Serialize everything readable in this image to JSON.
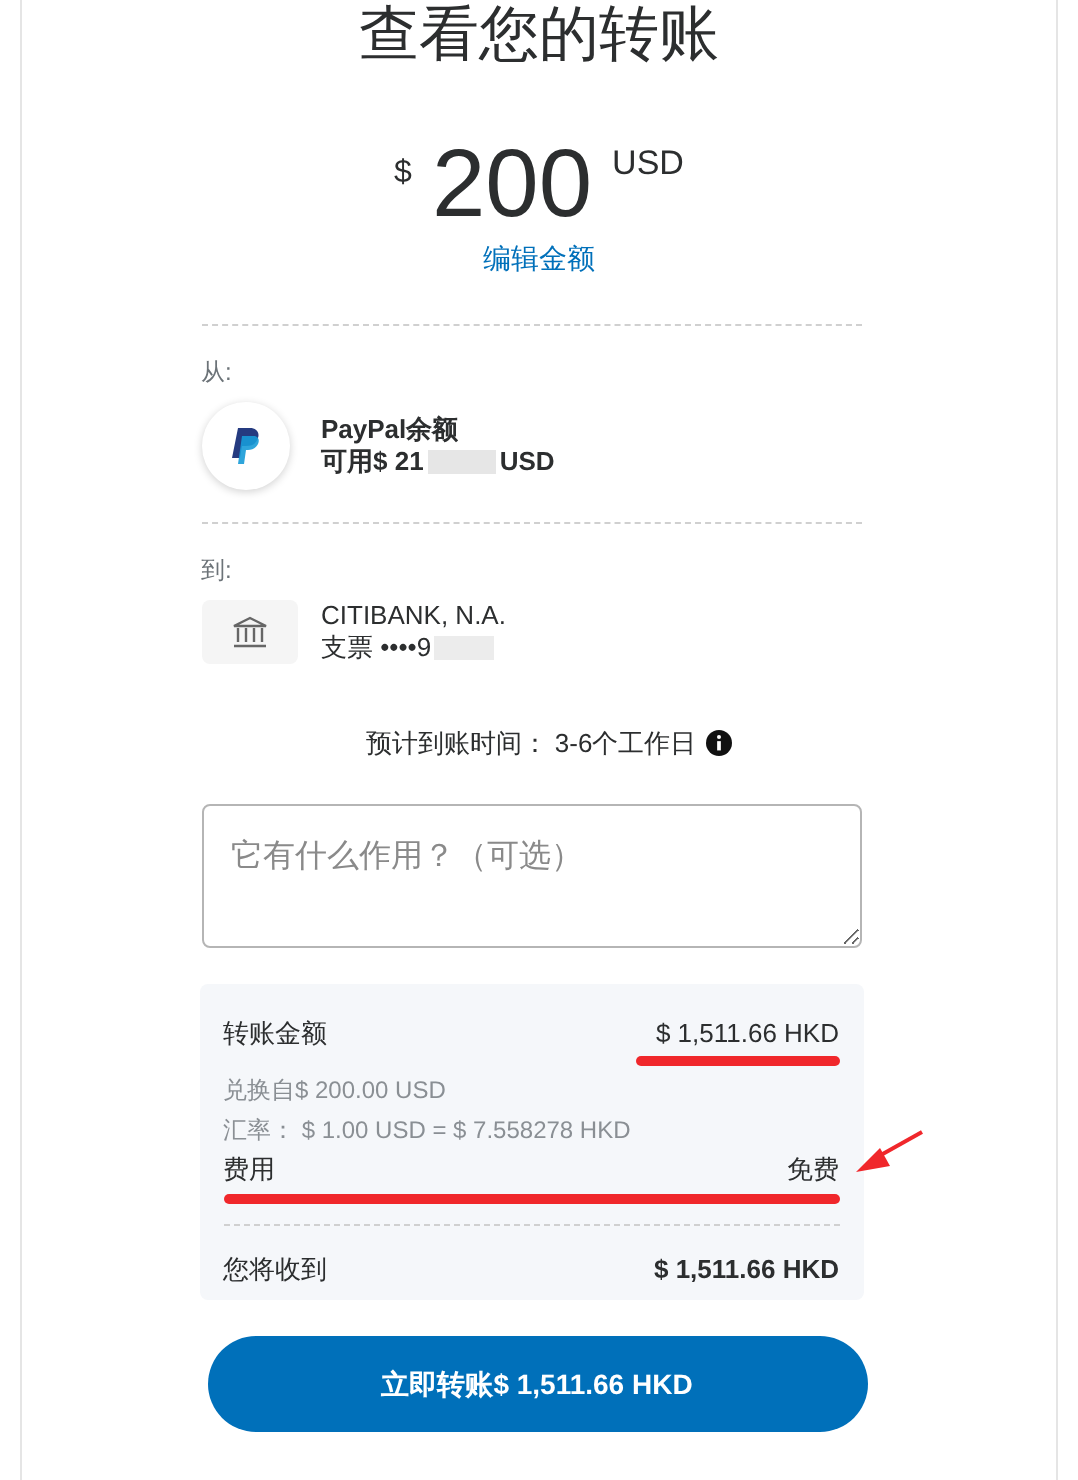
{
  "title": "查看您的转账",
  "amount": {
    "currency_symbol": "$",
    "value": "200",
    "currency": "USD",
    "edit_link": "编辑金额"
  },
  "from": {
    "label": "从:",
    "name": "PayPal余额",
    "balance_prefix": "可用$ 21",
    "balance_suffix": "USD"
  },
  "to": {
    "label": "到:",
    "name": "CITIBANK, N.A.",
    "account_prefix": "支票 ••••9"
  },
  "arrival": "预计到账时间： 3-6个工作日",
  "note": {
    "placeholder": "它有什么作用？（可选）"
  },
  "summary": {
    "rows": [
      {
        "kind": "main",
        "label": "转账金额",
        "value": "$ 1,511.66 HKD"
      },
      {
        "kind": "sub",
        "label": "兑换自$ 200.00 USD"
      },
      {
        "kind": "sub",
        "label": "汇率： $ 1.00 USD = $ 7.558278 HKD"
      },
      {
        "kind": "main",
        "label": "费用",
        "value": "免费"
      }
    ],
    "total": {
      "label": "您将收到",
      "value": "$ 1,511.66 HKD"
    }
  },
  "button": "立即转账$ 1,511.66 HKD"
}
